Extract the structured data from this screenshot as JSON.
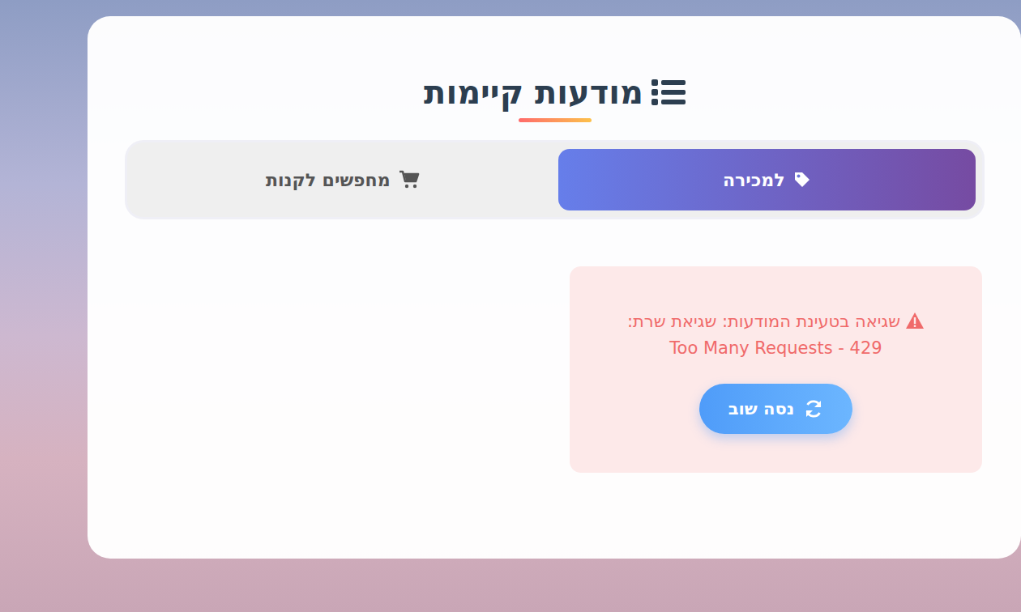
{
  "title": "מודעות קיימות",
  "tabs": [
    {
      "label": "למכירה",
      "selected": true
    },
    {
      "label": "מחפשים לקנות",
      "selected": false
    }
  ],
  "error": {
    "message": "שגיאה בטעינת המודעות: שגיאת שרת: 429 - Too Many Requests",
    "retry": "נסה שוב"
  }
}
